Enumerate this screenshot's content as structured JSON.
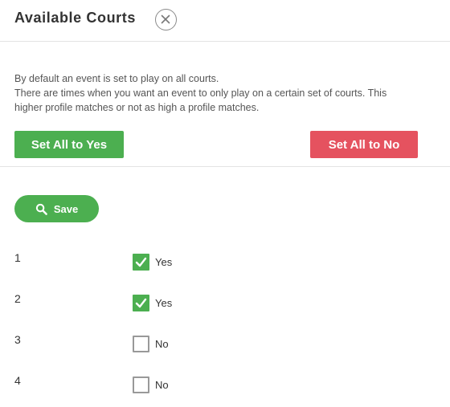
{
  "header": {
    "title": "Available Courts",
    "close_icon": "close-icon"
  },
  "description": {
    "line1": "By default an event is set to play on all courts.",
    "line2": "There are times when you want an event to only play on a certain set of courts. This",
    "line3": "higher profile matches or not as high a profile matches."
  },
  "actions": {
    "set_all_yes": "Set All to Yes",
    "set_all_no": "Set All to No",
    "save": "Save",
    "save_icon": "search-icon"
  },
  "courts": [
    {
      "number": "1",
      "checked": true,
      "label": "Yes"
    },
    {
      "number": "2",
      "checked": true,
      "label": "Yes"
    },
    {
      "number": "3",
      "checked": false,
      "label": "No"
    },
    {
      "number": "4",
      "checked": false,
      "label": "No"
    }
  ],
  "colors": {
    "accent_green": "#4caf50",
    "danger_red": "#e5525f"
  }
}
